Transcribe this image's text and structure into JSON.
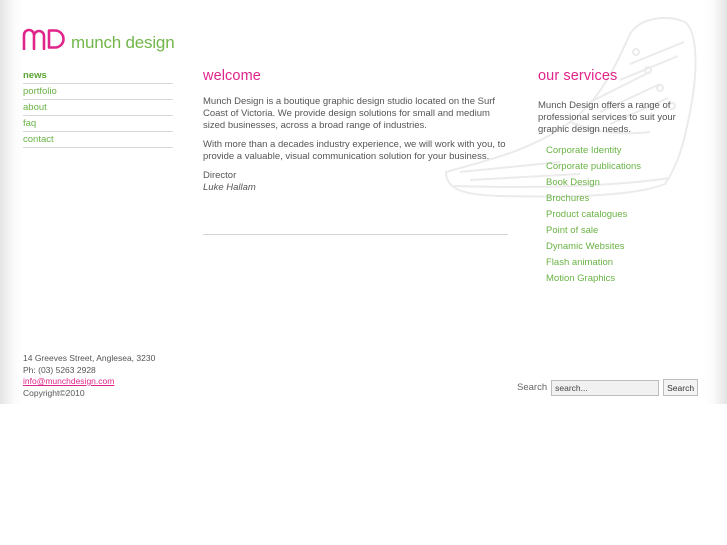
{
  "brand": {
    "name": "munch design",
    "pink": "#e0248a",
    "green": "#6ab244"
  },
  "nav": [
    {
      "label": "news",
      "active": true
    },
    {
      "label": "portfolio"
    },
    {
      "label": "about"
    },
    {
      "label": "faq"
    },
    {
      "label": "contact"
    }
  ],
  "welcome": {
    "heading": "welcome",
    "para1": "Munch Design is a boutique graphic design studio located on the Surf Coast of Victoria. We provide design solutions for small and medium sized businesses, across a broad range of industries.",
    "para2": "With more than a decades industry experience, we will work with you, to provide a valuable, visual communication solution for your business.",
    "role": "Director",
    "name": "Luke Hallam"
  },
  "services": {
    "heading": "our services",
    "intro": "Munch Design offers a range of professional services to suit your graphic design needs.",
    "items": [
      "Corporate Identity",
      "Corporate publications",
      "Book Design",
      "Brochures",
      "Product catalogues",
      "Point of sale",
      "Dynamic Websites",
      "Flash animation",
      "Motion Graphics"
    ]
  },
  "footer": {
    "address": "14 Greeves Street, Anglesea, 3230",
    "phone": "Ph: (03) 5263 2928",
    "email": "info@munchdesign.com",
    "copyright": "Copyright©2010"
  },
  "search": {
    "label": "Search",
    "placeholder": "search...",
    "button": "Search"
  }
}
